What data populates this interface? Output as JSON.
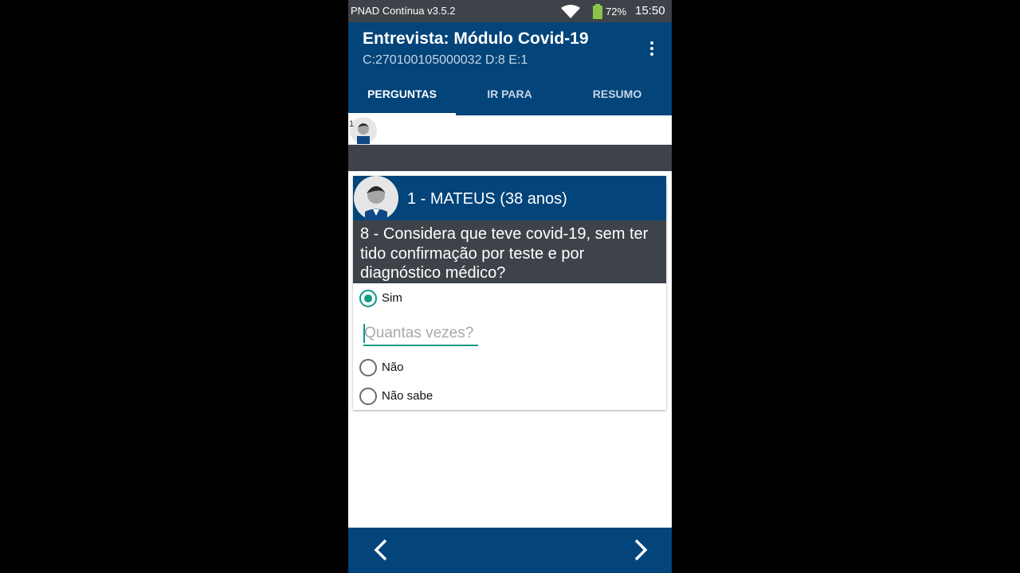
{
  "statusbar": {
    "app_name": "PNAD Contínua v3.5.2",
    "battery": "72%",
    "time": "15:50",
    "icons": [
      "wifi-icon",
      "battery-icon"
    ]
  },
  "appbar": {
    "title": "Entrevista: Módulo Covid-19",
    "subtitle": "C:270100105000032 D:8 E:1",
    "menu_icon": "overflow-menu-icon"
  },
  "tabs": [
    {
      "label": "PERGUNTAS",
      "active": true
    },
    {
      "label": "IR PARA",
      "active": false
    },
    {
      "label": "RESUMO",
      "active": false
    }
  ],
  "member_strip": {
    "number": "1",
    "icon": "person-avatar-icon"
  },
  "card": {
    "person": "1 - MATEUS (38 anos)",
    "question": "8 - Considera que teve covid-19, sem ter tido confirmação por teste e por diagnóstico médico?",
    "options": [
      {
        "label": "Sim",
        "selected": true
      },
      {
        "label": "Não",
        "selected": false
      },
      {
        "label": "Não sabe",
        "selected": false
      }
    ],
    "quantity_field": {
      "placeholder": "Quantas vezes?",
      "value": ""
    }
  },
  "bottombar": {
    "prev_icon": "chevron-left-icon",
    "next_icon": "chevron-right-icon"
  },
  "colors": {
    "primary": "#03447a",
    "dark": "#3e434a",
    "accent": "#0c9a86"
  }
}
